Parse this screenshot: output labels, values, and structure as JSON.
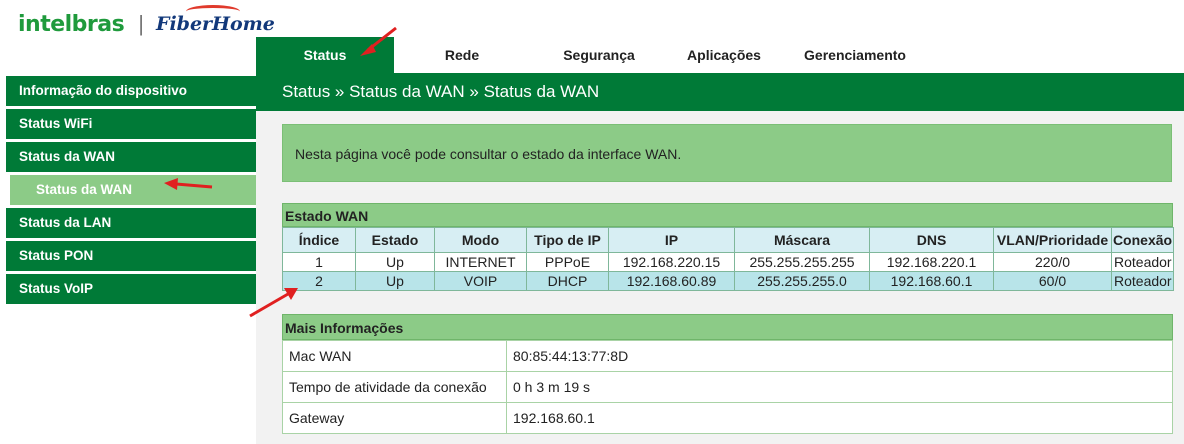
{
  "logo": {
    "brand1": "intelbras",
    "separator": "|",
    "brand2": "FiberHome"
  },
  "topnav": [
    {
      "label": "Status",
      "active": true
    },
    {
      "label": "Rede",
      "active": false
    },
    {
      "label": "Segurança",
      "active": false
    },
    {
      "label": "Aplicações",
      "active": false
    },
    {
      "label": "Gerenciamento",
      "active": false
    }
  ],
  "breadcrumb": "Status » Status da WAN » Status da WAN",
  "sidebar": {
    "items": [
      {
        "label": "Informação do dispositivo"
      },
      {
        "label": "Status WiFi"
      },
      {
        "label": "Status da WAN"
      },
      {
        "label": "Status da WAN",
        "sub": true
      },
      {
        "label": "Status da LAN"
      },
      {
        "label": "Status PON"
      },
      {
        "label": "Status VoIP"
      }
    ]
  },
  "info_text": "Nesta página você pode consultar o estado da interface WAN.",
  "wan": {
    "title": "Estado WAN",
    "headers": [
      "Índice",
      "Estado",
      "Modo",
      "Tipo de IP",
      "IP",
      "Máscara",
      "DNS",
      "VLAN/Prioridade",
      "Conexão"
    ],
    "rows": [
      [
        "1",
        "Up",
        "INTERNET",
        "PPPoE",
        "192.168.220.15",
        "255.255.255.255",
        "192.168.220.1",
        "220/0",
        "Roteador"
      ],
      [
        "2",
        "Up",
        "VOIP",
        "DHCP",
        "192.168.60.89",
        "255.255.255.0",
        "192.168.60.1",
        "60/0",
        "Roteador"
      ]
    ]
  },
  "more": {
    "title": "Mais Informações",
    "rows": [
      {
        "key": "Mac WAN",
        "value": "80:85:44:13:77:8D"
      },
      {
        "key": "Tempo de atividade da conexão",
        "value": "0 h 3 m 19 s"
      },
      {
        "key": "Gateway",
        "value": "192.168.60.1"
      }
    ]
  },
  "colors": {
    "primary_green": "#007a37",
    "light_green": "#8ccb87",
    "arrow_red": "#e02020"
  }
}
